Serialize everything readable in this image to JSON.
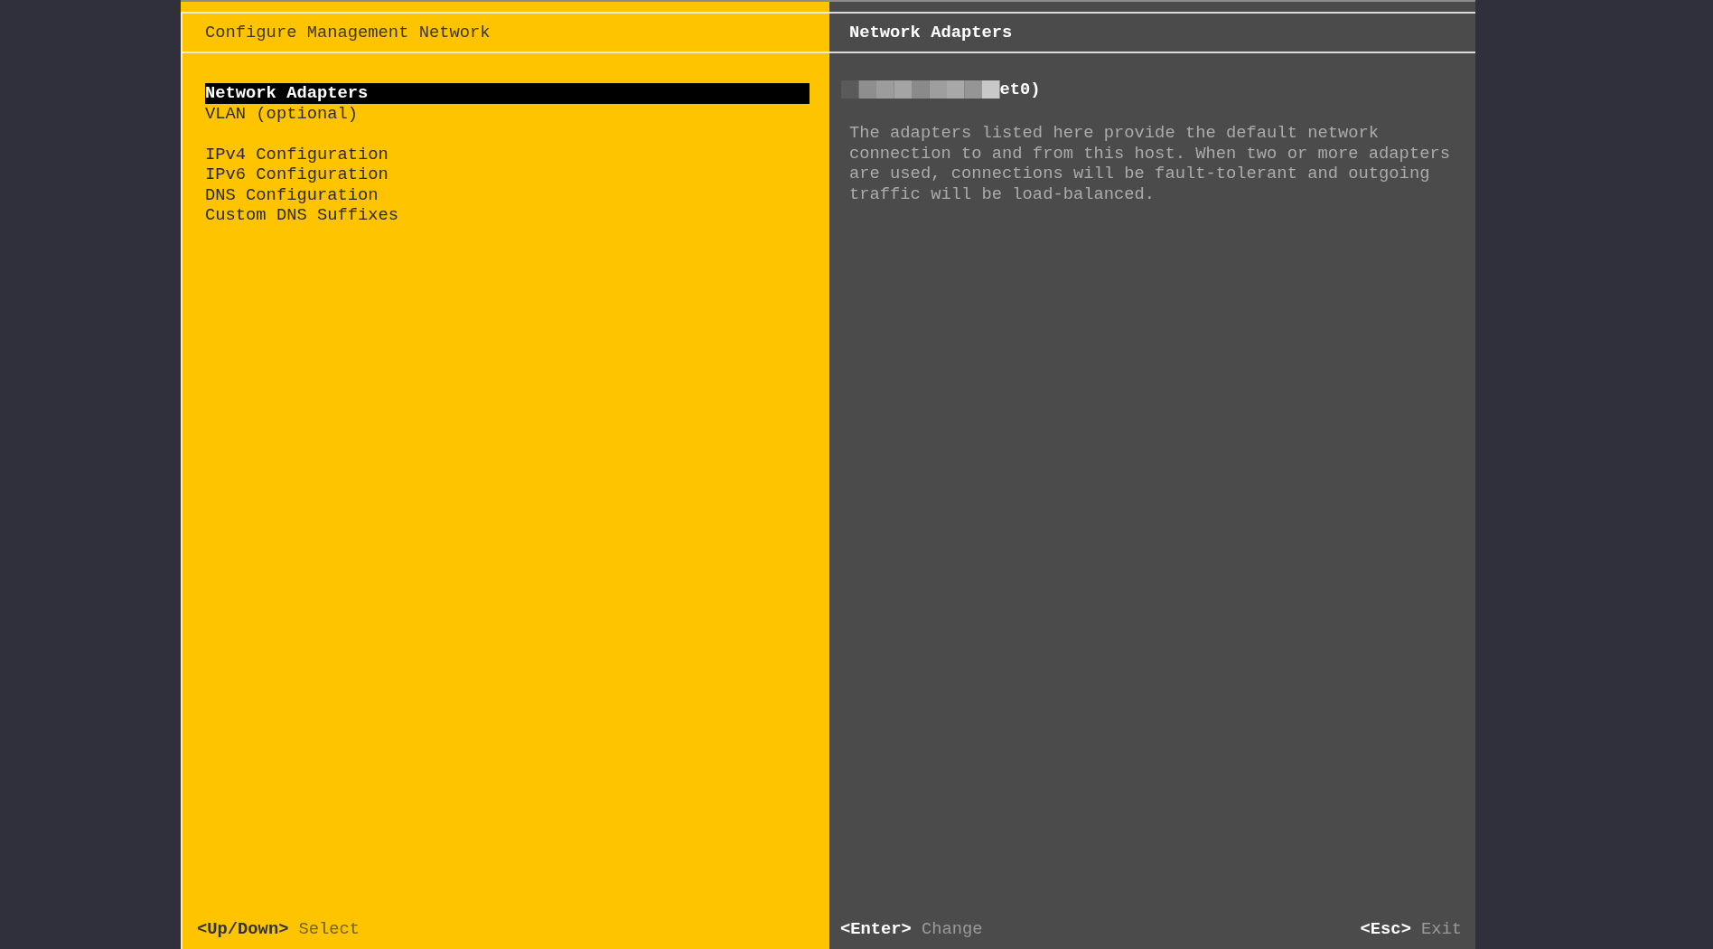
{
  "left_panel": {
    "title": "Configure Management Network",
    "menu_groups": [
      {
        "items": [
          {
            "label": "Network Adapters",
            "selected": true
          },
          {
            "label": "VLAN (optional)",
            "selected": false
          }
        ]
      },
      {
        "items": [
          {
            "label": "IPv4 Configuration",
            "selected": false
          },
          {
            "label": "IPv6 Configuration",
            "selected": false
          },
          {
            "label": "DNS Configuration",
            "selected": false
          },
          {
            "label": "Custom DNS Suffixes",
            "selected": false
          }
        ]
      }
    ],
    "hints": [
      {
        "key": "<Up/Down>",
        "action": "Select"
      }
    ]
  },
  "right_panel": {
    "title": "Network Adapters",
    "adapter": "et0)",
    "description": "The adapters listed here provide the default network connection to and from this host. When two or more adapters are used, connections will be fault-tolerant and outgoing traffic will be load-balanced.",
    "hints": [
      {
        "key": "<Enter>",
        "action": "Change"
      },
      {
        "key": "<Esc>",
        "action": "Exit"
      }
    ]
  }
}
